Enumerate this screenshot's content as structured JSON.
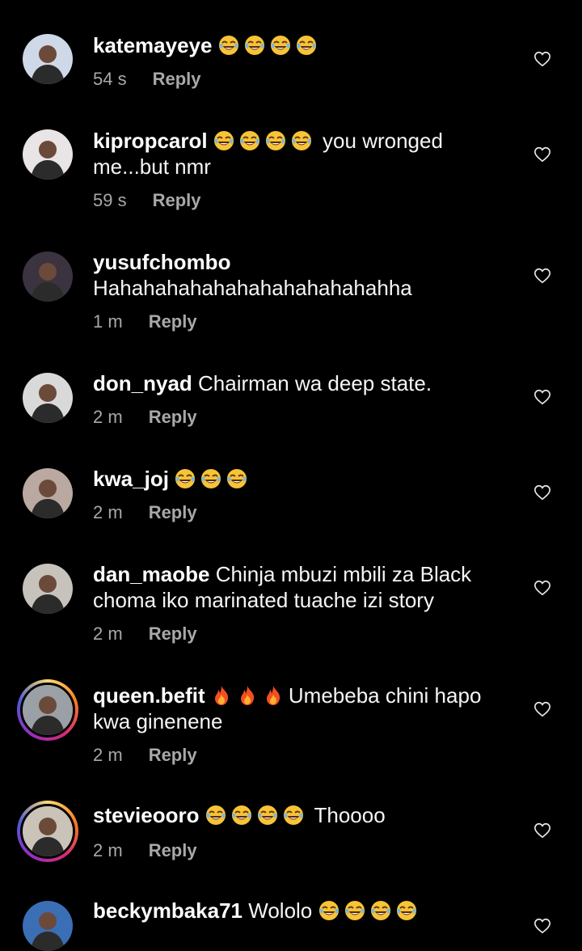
{
  "comments": [
    {
      "username": "katemayeye",
      "text_before": "",
      "emoji": "laugh",
      "emoji_count": 4,
      "text_after": "",
      "time": "54 s",
      "reply": "Reply",
      "avatar_color": "#cfd8e6",
      "story": false
    },
    {
      "username": "kipropcarol",
      "text_before": "",
      "emoji": "laugh",
      "emoji_count": 4,
      "text_after": " you wronged me...but nmr",
      "time": "59 s",
      "reply": "Reply",
      "avatar_color": "#e9e4e6",
      "story": false
    },
    {
      "username": "yusufchombo",
      "text_before": "Hahahahahahahahahahahahahha",
      "emoji": "",
      "emoji_count": 0,
      "text_after": "",
      "time": "1 m",
      "reply": "Reply",
      "avatar_color": "#3b3340",
      "story": false
    },
    {
      "username": "don_nyad",
      "text_before": "Chairman wa deep state.",
      "emoji": "",
      "emoji_count": 0,
      "text_after": "",
      "time": "2 m",
      "reply": "Reply",
      "avatar_color": "#d9d9d9",
      "story": false
    },
    {
      "username": "kwa_joj",
      "text_before": "",
      "emoji": "laugh",
      "emoji_count": 3,
      "text_after": "",
      "time": "2 m",
      "reply": "Reply",
      "avatar_color": "#b9a9a0",
      "story": false
    },
    {
      "username": "dan_maobe",
      "text_before": "Chinja mbuzi mbili za Black choma iko marinated tuache izi story",
      "emoji": "",
      "emoji_count": 0,
      "text_after": "",
      "time": "2 m",
      "reply": "Reply",
      "avatar_color": "#c8c2bc",
      "story": false
    },
    {
      "username": "queen.befit",
      "text_before": "",
      "emoji": "fire",
      "emoji_count": 3,
      "text_after": "Umebeba chini hapo kwa ginenene",
      "time": "2 m",
      "reply": "Reply",
      "avatar_color": "#9aa0a6",
      "story": true
    },
    {
      "username": "stevieooro",
      "text_before": "",
      "emoji": "laugh",
      "emoji_count": 4,
      "text_after": " Thoooo",
      "time": "2 m",
      "reply": "Reply",
      "avatar_color": "#c9c3b8",
      "story": true
    },
    {
      "username": "beckymbaka71",
      "text_before": "Wololo ",
      "emoji": "laugh",
      "emoji_count": 4,
      "text_after": "",
      "time": "",
      "reply": "",
      "avatar_color": "#3a6fb5",
      "story": false
    }
  ],
  "icons": {
    "like": "heart-outline-icon",
    "laugh": "face-with-tears-of-joy-icon",
    "fire": "fire-icon"
  },
  "colors": {
    "background": "#000000",
    "text": "#f5f5f5",
    "secondary": "#a8a8a8"
  }
}
